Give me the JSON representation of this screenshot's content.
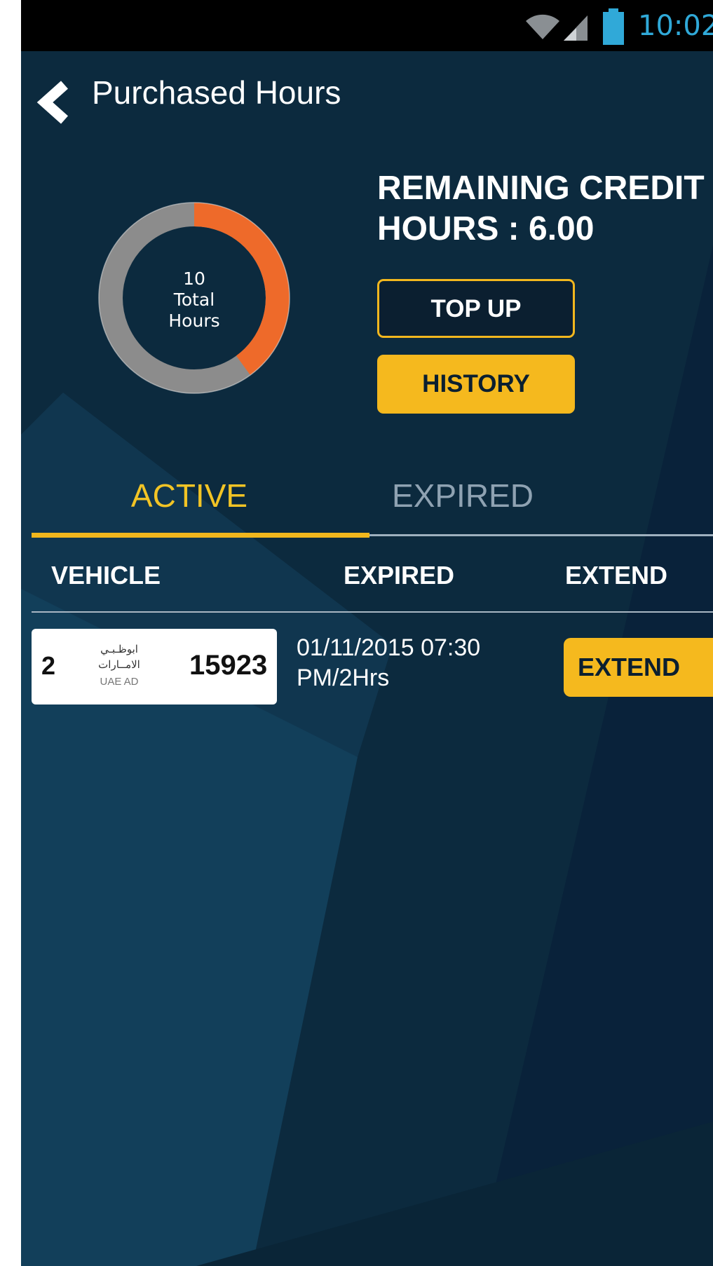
{
  "status_bar": {
    "time": "10:02",
    "icons": [
      "wifi-icon",
      "cell-signal-icon",
      "battery-icon"
    ]
  },
  "header": {
    "back_icon": "chevron-left-icon",
    "title": "Purchased Hours"
  },
  "summary": {
    "donut": {
      "total_value": "10",
      "line2": "Total",
      "line3": "Hours",
      "used_fraction": 0.4,
      "colors": {
        "used": "#ee6a2a",
        "remaining": "#8c8c8c"
      }
    },
    "credit_line1": "REMAINING CREDIT",
    "credit_line2": "HOURS : 6.00",
    "topup_label": "TOP UP",
    "history_label": "HISTORY"
  },
  "tabs": [
    {
      "label": "ACTIVE",
      "selected": true
    },
    {
      "label": "EXPIRED",
      "selected": false
    }
  ],
  "table": {
    "columns": [
      "VEHICLE",
      "EXPIRED",
      "EXTEND"
    ],
    "rows": [
      {
        "plate": {
          "code": "2",
          "emirate_ar_1": "ابوظـبـي",
          "emirate_ar_2": "الامــارات",
          "emirate_en": "UAE AD",
          "number": "15923"
        },
        "expired_line1": "01/11/2015 07:30",
        "expired_line2": "PM/2Hrs",
        "action_label": "EXTEND"
      }
    ]
  },
  "colors": {
    "background": "#0c2a3e",
    "accent": "#f5b91e",
    "active_tab": "#f2c425",
    "inactive_tab": "#8fa2b2",
    "status_time": "#30a9d8"
  }
}
